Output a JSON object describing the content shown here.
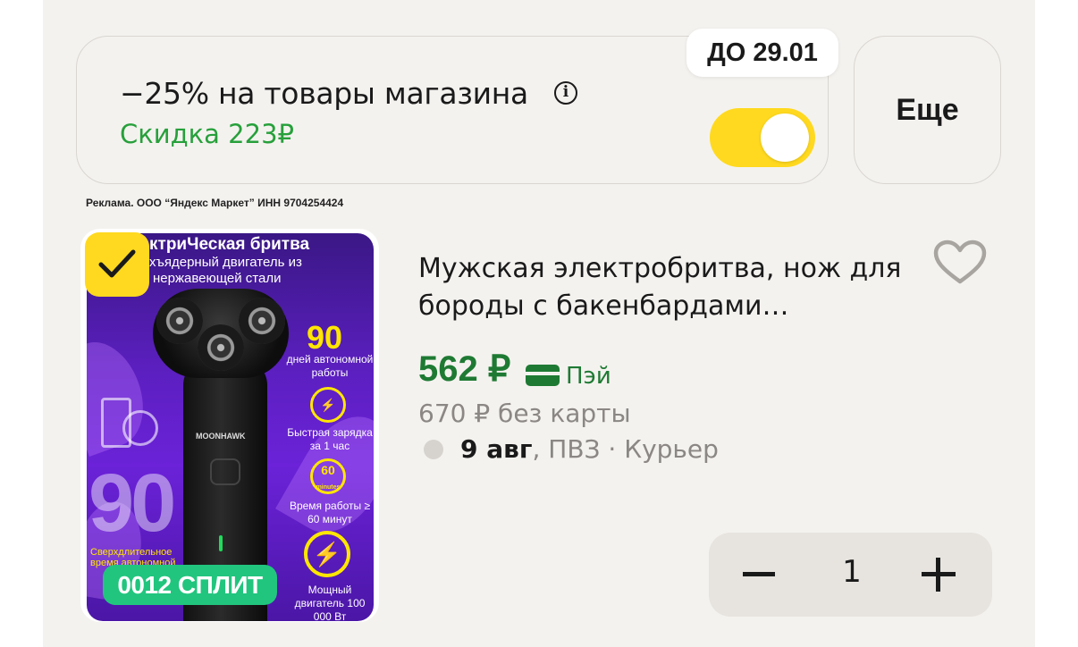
{
  "promo": {
    "title": "−25% на товары магазина",
    "discount": "Скидка 223₽",
    "deadline": "ДО 29.01",
    "toggle_on": true,
    "more_label": "Еще"
  },
  "ad_disclaimer": "Реклама. ООО “Яндекс Маркет” ИНН 9704254424",
  "product": {
    "image": {
      "headline": "ктриЧеская бритва",
      "subline1": "хъядерный двигатель из",
      "subline2": "нержавеющей стали",
      "brand": "MOONHAWK",
      "big_number": "90",
      "autonomy_number": "90",
      "autonomy_text": "дней автономной работы",
      "charge_text": "Быстрая зарядка за 1 час",
      "runtime_icon": "60",
      "runtime_icon_sub": "minutes",
      "runtime_text": "Время работы ≥ 60 минут",
      "power_text": "Мощный двигатель 100 000 Вт",
      "long_text": "Сверхдлительное время автономной"
    },
    "selected": true,
    "split_badge": "0012 СПЛИТ",
    "title": "Мужская электробритва, нож для бороды с бакенбардами…",
    "price": "562 ₽",
    "pay_label": "Пэй",
    "old_price": "670 ₽ без карты",
    "delivery_date": "9 авг",
    "delivery_rest": ", ПВЗ · Курьер",
    "quantity": "1"
  },
  "colors": {
    "accent_yellow": "#ffd91f",
    "price_green": "#1e7a33",
    "discount_green": "#27a03b",
    "split_green": "#21c57e"
  }
}
